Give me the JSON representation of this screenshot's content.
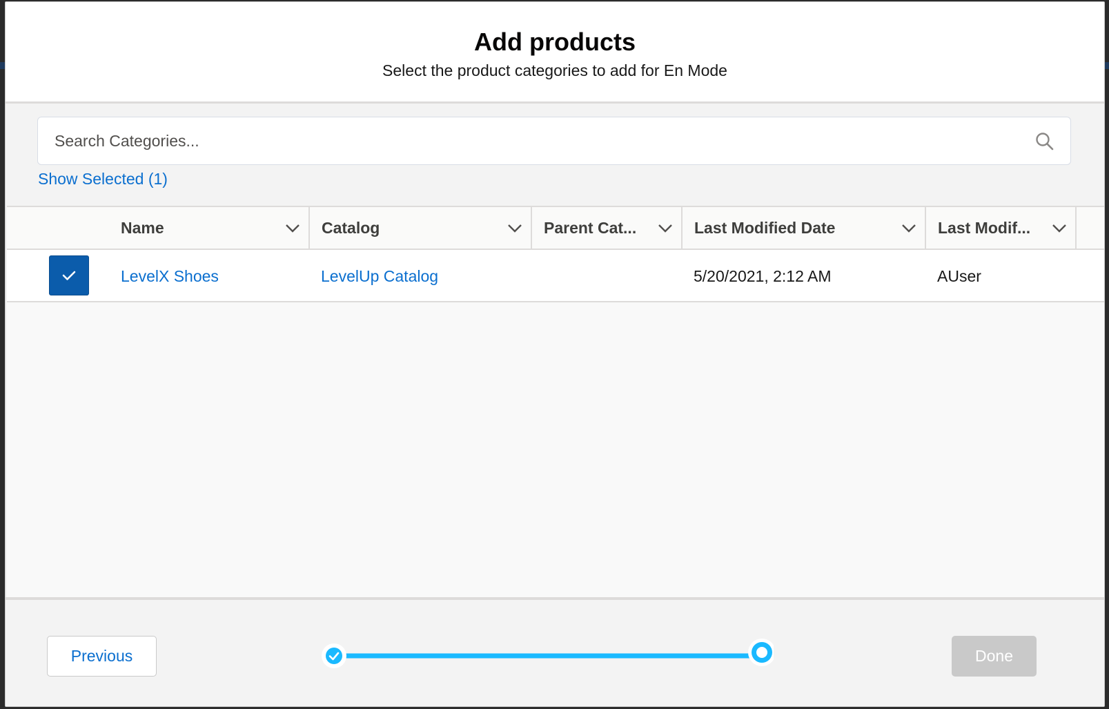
{
  "modal": {
    "title": "Add products",
    "subtitle": "Select the product categories to add for En Mode"
  },
  "search": {
    "placeholder": "Search Categories...",
    "value": "",
    "icon": "search-icon"
  },
  "show_selected_label": "Show Selected (1)",
  "table": {
    "columns": [
      "Name",
      "Catalog",
      "Parent Cat...",
      "Last Modified Date",
      "Last Modif..."
    ],
    "rows": [
      {
        "selected": true,
        "name": "LevelX Shoes",
        "catalog": "LevelUp Catalog",
        "parent_category": "",
        "last_modified_date": "5/20/2021, 2:12 AM",
        "last_modified_by": "AUser"
      }
    ]
  },
  "footer": {
    "previous_label": "Previous",
    "done_label": "Done",
    "progress": {
      "steps": 2,
      "completed_steps": 1,
      "current_step": 2
    }
  },
  "colors": {
    "brand_blue": "#0b5cab",
    "link_blue": "#0b6fcf",
    "progress_blue": "#1ab9ff",
    "disabled_gray": "#c9c9c9"
  }
}
